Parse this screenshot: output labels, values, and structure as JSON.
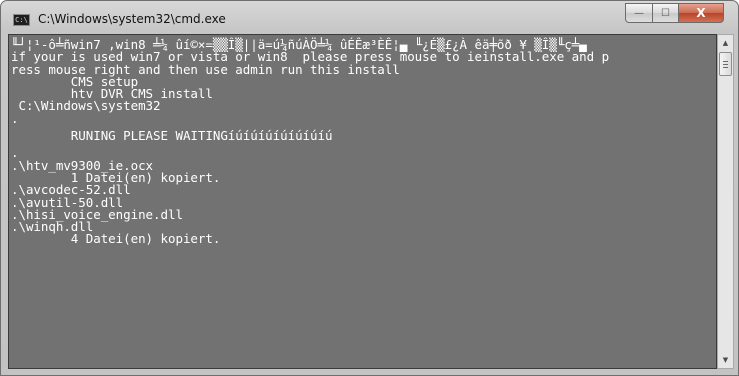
{
  "window": {
    "title": "C:\\Windows\\system32\\cmd.exe",
    "icon_label": "C:\\"
  },
  "caption_buttons": {
    "minimize": "—",
    "maximize": "☐",
    "close": "X"
  },
  "console": {
    "lines": [
      "╙┘¦¹-ô╧ñwin7 ,win8 ╧¼ ûí©×=▒▒Î▒||ä=ú¼ñúÀÖ╧¼ ûÉÊæ³ÈÊ¦▄ ╙¿É▒£¿À êä╪õð ¥ ▒Î▒╙ç╧▄",
      "if your is used win7 or vista or win8  please press mouse to ieinstall.exe and p",
      "ress mouse right and then use admin run this install",
      "        CMS setup",
      "        htv DVR CMS install",
      " C:\\Windows\\system32",
      ".",
      "        RUNING PLEASE WAITINGíúíúíúíúíúíúíú",
      ".",
      ".\\htv_mv9300_ie.ocx",
      "        1 Datei(en) kopiert.",
      ".\\avcodec-52.dll",
      ".\\avutil-50.dll",
      ".\\hisi_voice_engine.dll",
      ".\\winqh.dll",
      "        4 Datei(en) kopiert."
    ]
  },
  "scrollbar": {
    "up_arrow": "▲",
    "down_arrow": "▼"
  }
}
